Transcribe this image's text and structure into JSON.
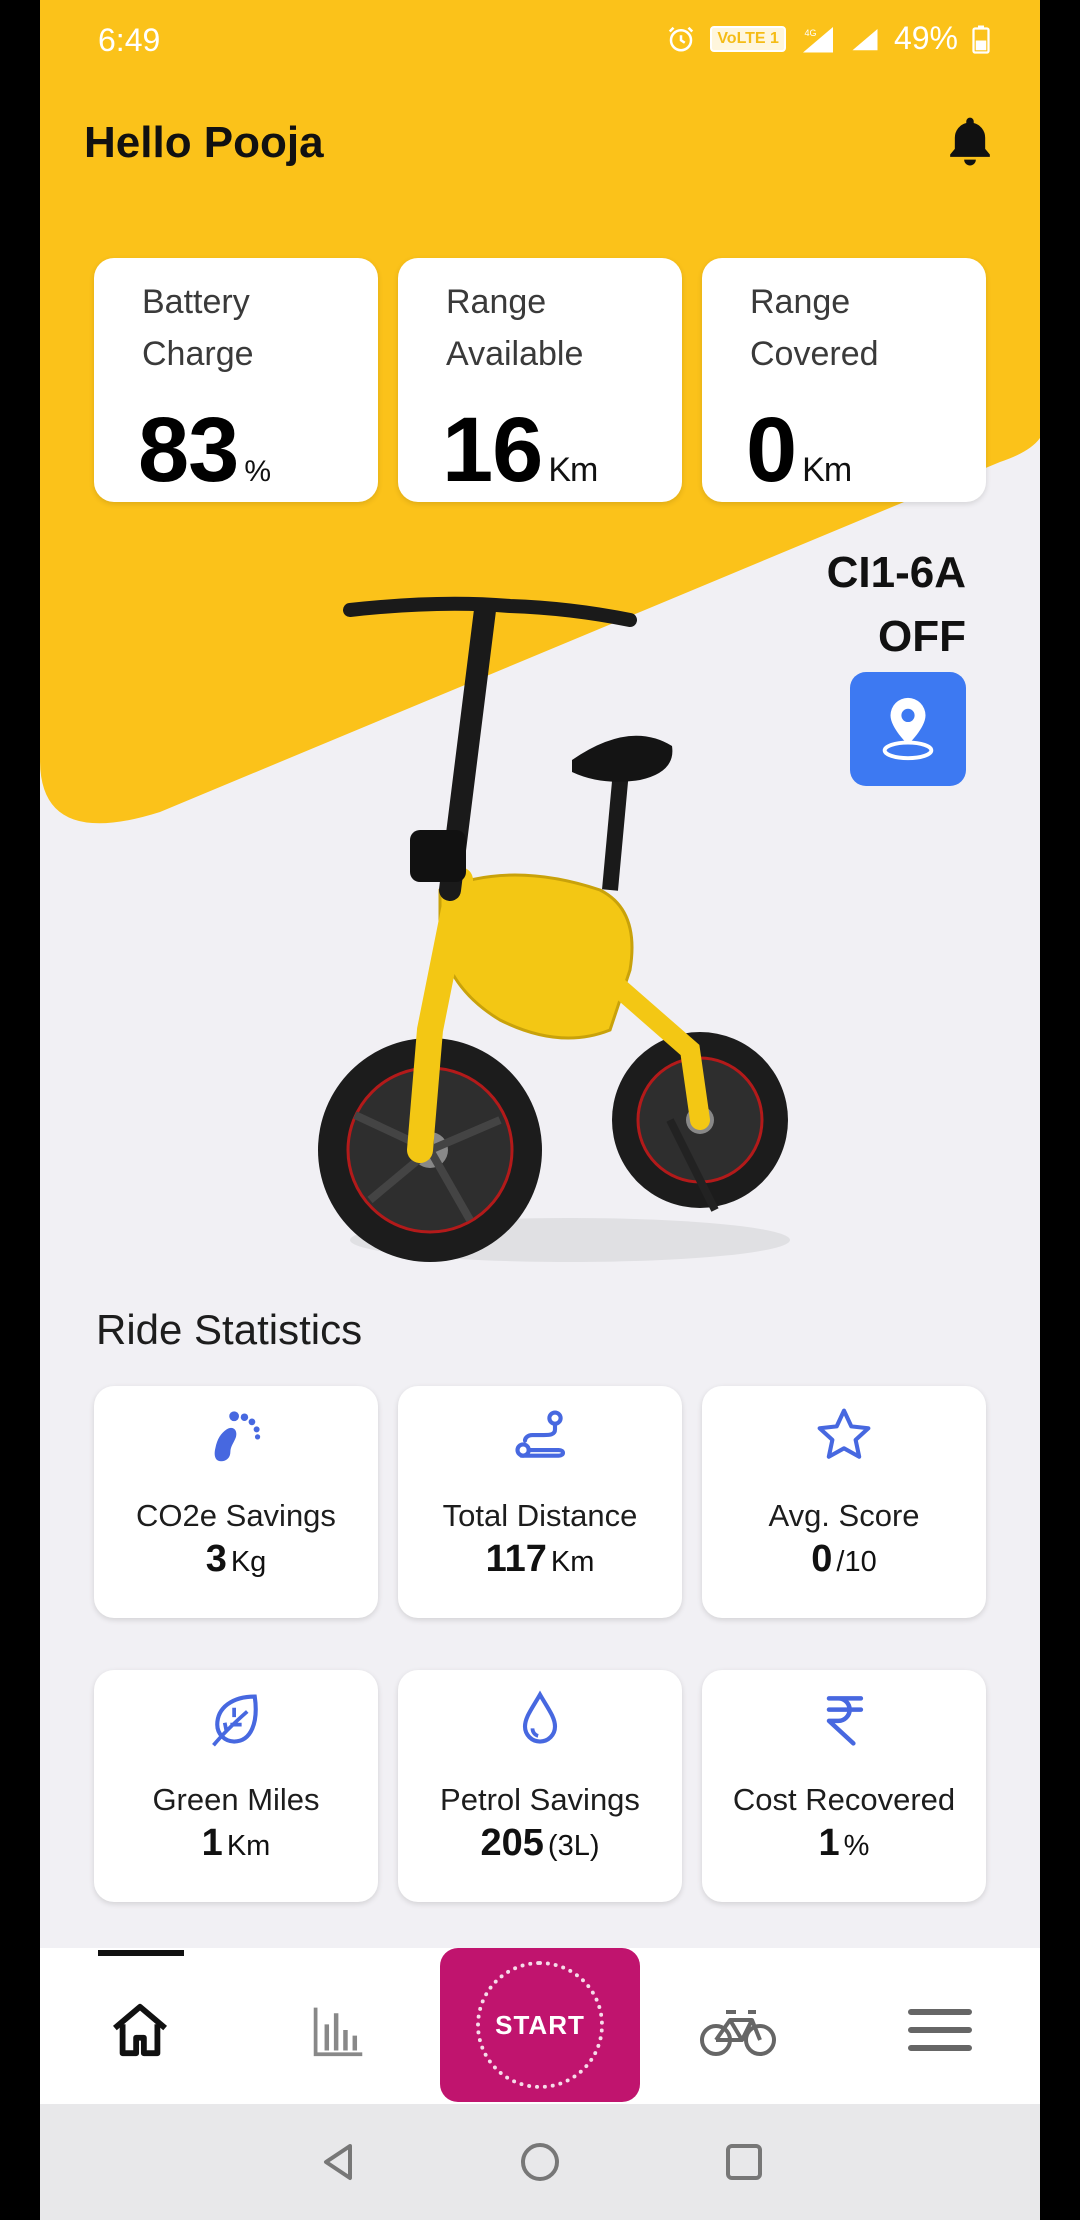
{
  "status_bar": {
    "time": "6:49",
    "network_badge": "VoLTE 1",
    "network_type": "4G",
    "battery": "49%"
  },
  "header": {
    "greeting": "Hello Pooja",
    "icons": [
      "bell-icon"
    ]
  },
  "summary_cards": [
    {
      "label": "Battery Charge",
      "value": "83",
      "unit": "%"
    },
    {
      "label": "Range Available",
      "value": "16",
      "unit": "Km"
    },
    {
      "label": "Range Covered",
      "value": "0",
      "unit": "Km"
    }
  ],
  "vehicle": {
    "id": "CI1-6A",
    "status": "OFF",
    "locate_icon": "location-pin-icon"
  },
  "ride_statistics": {
    "title": "Ride Statistics",
    "cards": [
      {
        "icon": "footprint-icon",
        "label": "CO2e Savings",
        "value": "3",
        "unit": "Kg"
      },
      {
        "icon": "route-icon",
        "label": "Total Distance",
        "value": "117",
        "unit": "Km"
      },
      {
        "icon": "star-icon",
        "label": "Avg. Score",
        "value": "0",
        "unit": "/10"
      },
      {
        "icon": "leaf-icon",
        "label": "Green Miles",
        "value": "1",
        "unit": "Km"
      },
      {
        "icon": "drop-icon",
        "label": "Petrol Savings",
        "value": "205",
        "unit": "(3L)"
      },
      {
        "icon": "rupee-icon",
        "label": "Cost Recovered",
        "value": "1",
        "unit": "%"
      }
    ]
  },
  "bottom_nav": {
    "items": [
      "home-icon",
      "stats-icon",
      "bicycle-icon",
      "menu-icon"
    ],
    "start_label": "START",
    "active": "home"
  },
  "colors": {
    "brand_yellow": "#fbc21a",
    "accent_blue": "#3d79f2",
    "icon_blue": "#4768e0",
    "start_magenta": "#c0146e"
  }
}
